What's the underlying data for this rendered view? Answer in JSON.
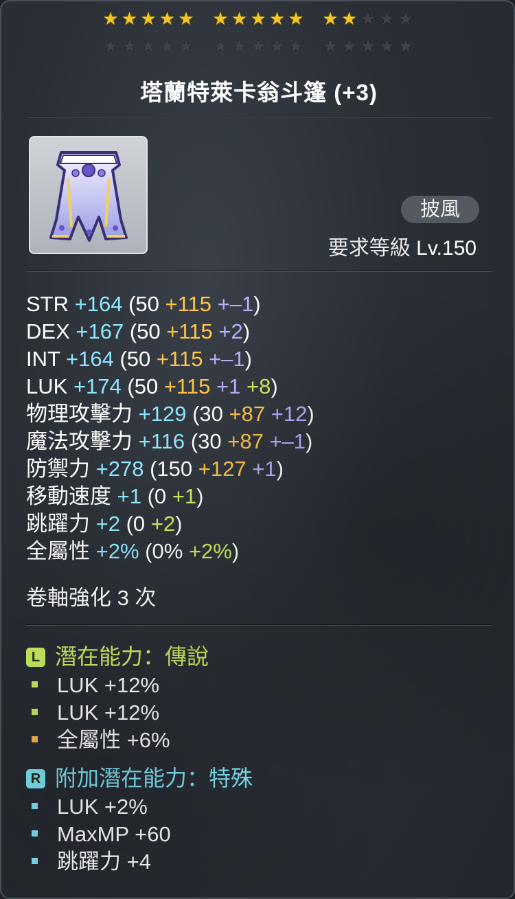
{
  "stars": {
    "row1": [
      [
        true,
        true,
        true,
        true,
        true
      ],
      [
        true,
        true,
        true,
        true,
        true
      ],
      [
        true,
        true,
        false,
        false,
        false
      ]
    ],
    "row2": [
      [
        false,
        false,
        false,
        false,
        false
      ],
      [
        false,
        false,
        false,
        false,
        false
      ],
      [
        false,
        false,
        false,
        false,
        false
      ]
    ],
    "filled_count": 12,
    "total_count": 30
  },
  "item": {
    "name": "塔蘭特萊卡翁斗篷 (+3)",
    "icon": "cape-icon",
    "type": "披風",
    "req_label": "要求等級",
    "req_level": "Lv.150"
  },
  "stats": [
    {
      "label": "STR",
      "total": "+164",
      "base": "(50",
      "parts": [
        {
          "text": "+115",
          "kind": "star"
        },
        {
          "text": "+–1",
          "kind": "scroll"
        }
      ],
      "close": ")"
    },
    {
      "label": "DEX",
      "total": "+167",
      "base": "(50",
      "parts": [
        {
          "text": "+115",
          "kind": "star"
        },
        {
          "text": "+2",
          "kind": "scroll"
        }
      ],
      "close": ")"
    },
    {
      "label": "INT",
      "total": "+164",
      "base": "(50",
      "parts": [
        {
          "text": "+115",
          "kind": "star"
        },
        {
          "text": "+–1",
          "kind": "scroll"
        }
      ],
      "close": ")"
    },
    {
      "label": "LUK",
      "total": "+174",
      "base": "(50",
      "parts": [
        {
          "text": "+115",
          "kind": "star"
        },
        {
          "text": "+1",
          "kind": "scroll"
        },
        {
          "text": "+8",
          "kind": "flame"
        }
      ],
      "close": ")"
    },
    {
      "label": "物理攻擊力",
      "total": "+129",
      "base": "(30",
      "parts": [
        {
          "text": "+87",
          "kind": "star"
        },
        {
          "text": "+12",
          "kind": "scroll"
        }
      ],
      "close": ")"
    },
    {
      "label": "魔法攻擊力",
      "total": "+116",
      "base": "(30",
      "parts": [
        {
          "text": "+87",
          "kind": "star"
        },
        {
          "text": "+–1",
          "kind": "scroll"
        }
      ],
      "close": ")"
    },
    {
      "label": "防禦力",
      "total": "+278",
      "base": "(150",
      "parts": [
        {
          "text": "+127",
          "kind": "star"
        },
        {
          "text": "+1",
          "kind": "scroll"
        }
      ],
      "close": ")"
    },
    {
      "label": "移動速度",
      "total": "+1",
      "base": "(0",
      "parts": [
        {
          "text": "+1",
          "kind": "flame"
        }
      ],
      "close": ")"
    },
    {
      "label": "跳躍力",
      "total": "+2",
      "base": "(0",
      "parts": [
        {
          "text": "+2",
          "kind": "flame"
        }
      ],
      "close": ")"
    },
    {
      "label": "全屬性",
      "total": "+2%",
      "base": "(0%",
      "parts": [
        {
          "text": "+2%",
          "kind": "flame"
        }
      ],
      "close": ")"
    }
  ],
  "scroll_upgrade": "卷軸強化 3 次",
  "potential": {
    "badge": "L",
    "title": "潛在能力：傳說",
    "color": "#cdf062",
    "lines": [
      {
        "text": "LUK +12%",
        "bullet_color": "#cdf062"
      },
      {
        "text": "LUK +12%",
        "bullet_color": "#cdf062"
      },
      {
        "text": "全屬性 +6%",
        "bullet_color": "#ffb84a"
      }
    ]
  },
  "additional_potential": {
    "badge": "R",
    "title": "附加潛在能力：特殊",
    "color": "#7fe4f5",
    "lines": [
      {
        "text": "LUK +2%",
        "bullet_color": "#7fe4f5"
      },
      {
        "text": "MaxMP +60",
        "bullet_color": "#7fe4f5"
      },
      {
        "text": "跳躍力 +4",
        "bullet_color": "#7fe4f5"
      }
    ]
  }
}
